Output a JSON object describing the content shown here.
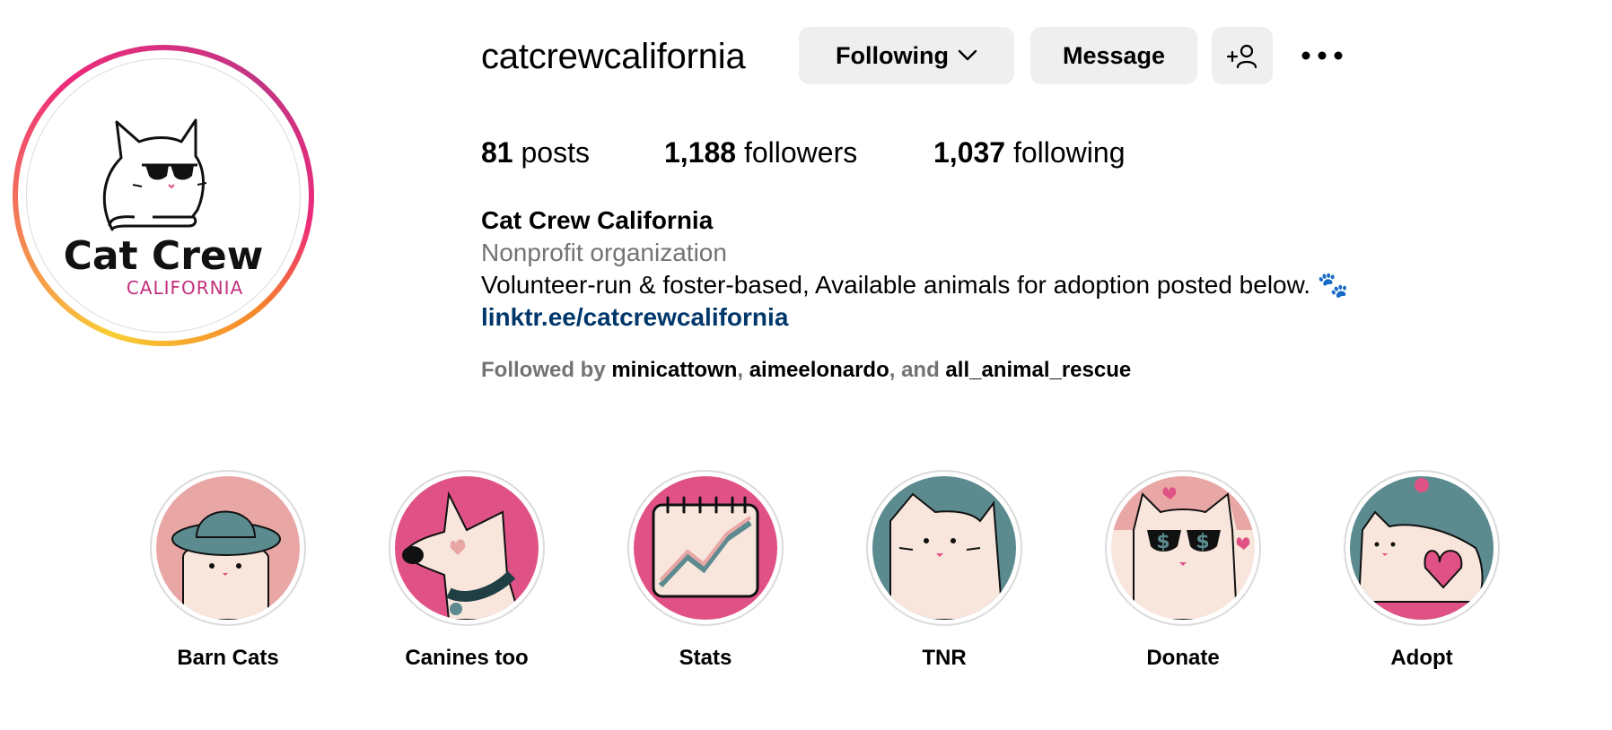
{
  "profile": {
    "username": "catcrewcalifornia",
    "logo_text_top": "Cat Crew",
    "logo_text_bottom": "CALIFORNIA"
  },
  "actions": {
    "following_label": "Following",
    "message_label": "Message",
    "add_user_icon": "add-user-icon",
    "more_icon": "more-options-icon"
  },
  "stats": {
    "posts_count": "81",
    "posts_label": "posts",
    "followers_count": "1,188",
    "followers_label": "followers",
    "following_count": "1,037",
    "following_label": "following"
  },
  "bio": {
    "name": "Cat Crew California",
    "category": "Nonprofit organization",
    "text": "Volunteer-run & foster-based, Available animals for adoption posted below. 🐾",
    "link": "linktr.ee/catcrewcalifornia"
  },
  "followed_by": {
    "prefix": "Followed by ",
    "accounts": [
      "minicattown",
      "aimeelonardo",
      "all_animal_rescue"
    ],
    "sep1": ", ",
    "sep2": ", and "
  },
  "highlights": [
    {
      "label": "Barn Cats"
    },
    {
      "label": "Canines too"
    },
    {
      "label": "Stats"
    },
    {
      "label": "TNR"
    },
    {
      "label": "Donate"
    },
    {
      "label": "Adopt"
    }
  ],
  "colors": {
    "link_blue": "#00376b",
    "muted_gray": "#737373",
    "button_gray": "#efefef",
    "brand_pink": "#c2307c",
    "highlight_pink": "#e05285",
    "highlight_teal": "#5b8a8f",
    "highlight_blush": "#e8a7a5",
    "cream": "#f8e6dc"
  }
}
